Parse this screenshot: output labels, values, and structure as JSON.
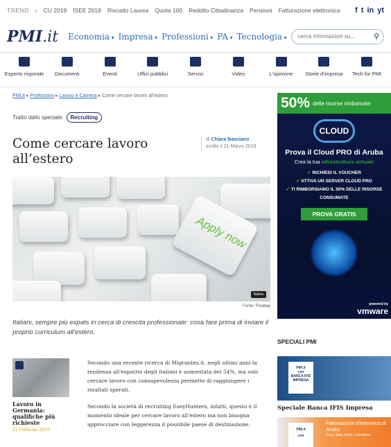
{
  "trend": {
    "label": "TREND",
    "items": [
      "CU 2019",
      "ISEE 2019",
      "Riscatto Laurea",
      "Quota 100",
      "Reddito Cittadinanza",
      "Pensioni",
      "Fatturazione elettronica"
    ],
    "social": [
      "f",
      "t",
      "in",
      "yt"
    ]
  },
  "logo": {
    "name": "PMI",
    "suffix": ".it"
  },
  "nav": {
    "items": [
      "Economia",
      "Impresa",
      "Professioni",
      "PA",
      "Tecnologia"
    ],
    "search_placeholder": "cerca informazioni su..."
  },
  "iconbar": [
    "Esperto risponde",
    "Documenti",
    "Eventi",
    "Uffici pubblici",
    "Servizi",
    "Video",
    "L'opinione",
    "Storie d'impresa",
    "Tech for PMI"
  ],
  "breadcrumb": {
    "items": [
      "PMI.it",
      "Professioni",
      "Lavoro e Carriera"
    ],
    "current": "Come cercare lavoro all'estero"
  },
  "special": {
    "label": "Tratto dallo speciale:",
    "tag": "Recruiting"
  },
  "article": {
    "title": "Come cercare lavoro all’estero",
    "by_prefix": "di",
    "author": "Chiara Basciano",
    "date": "scritto il 21 Marzo 2019",
    "hero_text": "Apply now",
    "hero_badge": "Nativa",
    "source": "Fonte: Pixabay",
    "lead": "Italiani, sempre più expats in cerca di crescita professionale: cosa fare prima di inviare il proprio curriculum all'estero.",
    "paragraphs": [
      "Secondo una recente ricerca di Migrantes.it, negli ultimi anni la tendenza all'espatrio degli italiani è aumentata del 54%, ma solo cercare lavoro con consapevolezza permette di raggiungere i risultati sperati.",
      "Secondo la società di recruiting EasyHunters, infatti, questo è il momento ideale per cercare lavoro all'estero ma non bisogna approcciare con leggerezza il possibile paese di destinazione."
    ]
  },
  "related": {
    "title": "Lavoro in Germania: qualifiche più richieste",
    "date": "21 Febbraio 2019"
  },
  "ad": {
    "percent": "50%",
    "percent_text": "delle risorse rimborsate",
    "logo_top": "aruba",
    "logo": "CLOUD",
    "headline": "Prova il Cloud PRO di Aruba",
    "sub_prefix": "Crea la tua",
    "sub_highlight": "infrastruttura virtuale",
    "bullets": [
      "RICHIEDI IL VOUCHER",
      "ATTIVA UN SERVER CLOUD PRO",
      "TI RIMBORSIAMO IL 50% DELLE RISORSE CONSUMATE"
    ],
    "cta": "PROVA GRATIS",
    "vm_small": "powered by",
    "vm": "vmware"
  },
  "speciali": {
    "heading": "SPECIALI PMI",
    "card1_brand": "PMI.it",
    "card1_with": "con",
    "card1_partner": "BANCA IFIS IMPRESA",
    "card1_title": "Speciale Banca IFIS Impresa",
    "card2_brand": "PMI.it",
    "card2_with": "con",
    "card2_text": "Fatturazione Elettronica di Aruba",
    "card2_small": "Crea, invia, ricevi e conserva."
  }
}
